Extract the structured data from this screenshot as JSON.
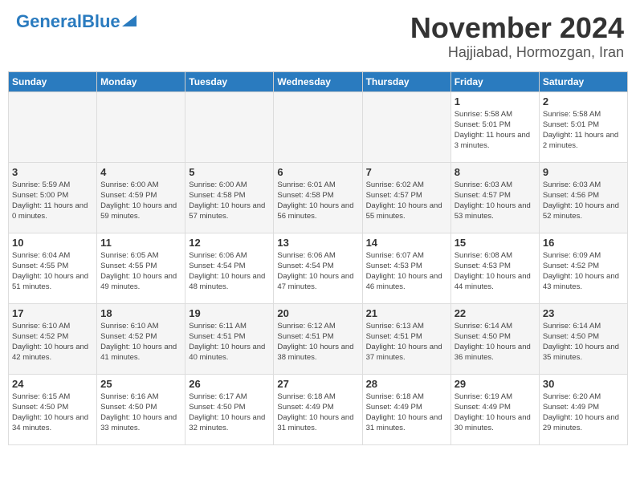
{
  "header": {
    "logo_general": "General",
    "logo_blue": "Blue",
    "month": "November 2024",
    "location": "Hajjiabad, Hormozgan, Iran"
  },
  "days_of_week": [
    "Sunday",
    "Monday",
    "Tuesday",
    "Wednesday",
    "Thursday",
    "Friday",
    "Saturday"
  ],
  "weeks": [
    [
      {
        "day": "",
        "empty": true
      },
      {
        "day": "",
        "empty": true
      },
      {
        "day": "",
        "empty": true
      },
      {
        "day": "",
        "empty": true
      },
      {
        "day": "",
        "empty": true
      },
      {
        "day": "1",
        "sunrise": "5:58 AM",
        "sunset": "5:01 PM",
        "daylight": "11 hours and 3 minutes."
      },
      {
        "day": "2",
        "sunrise": "5:58 AM",
        "sunset": "5:01 PM",
        "daylight": "11 hours and 2 minutes."
      }
    ],
    [
      {
        "day": "3",
        "sunrise": "5:59 AM",
        "sunset": "5:00 PM",
        "daylight": "11 hours and 0 minutes."
      },
      {
        "day": "4",
        "sunrise": "6:00 AM",
        "sunset": "4:59 PM",
        "daylight": "10 hours and 59 minutes."
      },
      {
        "day": "5",
        "sunrise": "6:00 AM",
        "sunset": "4:58 PM",
        "daylight": "10 hours and 57 minutes."
      },
      {
        "day": "6",
        "sunrise": "6:01 AM",
        "sunset": "4:58 PM",
        "daylight": "10 hours and 56 minutes."
      },
      {
        "day": "7",
        "sunrise": "6:02 AM",
        "sunset": "4:57 PM",
        "daylight": "10 hours and 55 minutes."
      },
      {
        "day": "8",
        "sunrise": "6:03 AM",
        "sunset": "4:57 PM",
        "daylight": "10 hours and 53 minutes."
      },
      {
        "day": "9",
        "sunrise": "6:03 AM",
        "sunset": "4:56 PM",
        "daylight": "10 hours and 52 minutes."
      }
    ],
    [
      {
        "day": "10",
        "sunrise": "6:04 AM",
        "sunset": "4:55 PM",
        "daylight": "10 hours and 51 minutes."
      },
      {
        "day": "11",
        "sunrise": "6:05 AM",
        "sunset": "4:55 PM",
        "daylight": "10 hours and 49 minutes."
      },
      {
        "day": "12",
        "sunrise": "6:06 AM",
        "sunset": "4:54 PM",
        "daylight": "10 hours and 48 minutes."
      },
      {
        "day": "13",
        "sunrise": "6:06 AM",
        "sunset": "4:54 PM",
        "daylight": "10 hours and 47 minutes."
      },
      {
        "day": "14",
        "sunrise": "6:07 AM",
        "sunset": "4:53 PM",
        "daylight": "10 hours and 46 minutes."
      },
      {
        "day": "15",
        "sunrise": "6:08 AM",
        "sunset": "4:53 PM",
        "daylight": "10 hours and 44 minutes."
      },
      {
        "day": "16",
        "sunrise": "6:09 AM",
        "sunset": "4:52 PM",
        "daylight": "10 hours and 43 minutes."
      }
    ],
    [
      {
        "day": "17",
        "sunrise": "6:10 AM",
        "sunset": "4:52 PM",
        "daylight": "10 hours and 42 minutes."
      },
      {
        "day": "18",
        "sunrise": "6:10 AM",
        "sunset": "4:52 PM",
        "daylight": "10 hours and 41 minutes."
      },
      {
        "day": "19",
        "sunrise": "6:11 AM",
        "sunset": "4:51 PM",
        "daylight": "10 hours and 40 minutes."
      },
      {
        "day": "20",
        "sunrise": "6:12 AM",
        "sunset": "4:51 PM",
        "daylight": "10 hours and 38 minutes."
      },
      {
        "day": "21",
        "sunrise": "6:13 AM",
        "sunset": "4:51 PM",
        "daylight": "10 hours and 37 minutes."
      },
      {
        "day": "22",
        "sunrise": "6:14 AM",
        "sunset": "4:50 PM",
        "daylight": "10 hours and 36 minutes."
      },
      {
        "day": "23",
        "sunrise": "6:14 AM",
        "sunset": "4:50 PM",
        "daylight": "10 hours and 35 minutes."
      }
    ],
    [
      {
        "day": "24",
        "sunrise": "6:15 AM",
        "sunset": "4:50 PM",
        "daylight": "10 hours and 34 minutes."
      },
      {
        "day": "25",
        "sunrise": "6:16 AM",
        "sunset": "4:50 PM",
        "daylight": "10 hours and 33 minutes."
      },
      {
        "day": "26",
        "sunrise": "6:17 AM",
        "sunset": "4:50 PM",
        "daylight": "10 hours and 32 minutes."
      },
      {
        "day": "27",
        "sunrise": "6:18 AM",
        "sunset": "4:49 PM",
        "daylight": "10 hours and 31 minutes."
      },
      {
        "day": "28",
        "sunrise": "6:18 AM",
        "sunset": "4:49 PM",
        "daylight": "10 hours and 31 minutes."
      },
      {
        "day": "29",
        "sunrise": "6:19 AM",
        "sunset": "4:49 PM",
        "daylight": "10 hours and 30 minutes."
      },
      {
        "day": "30",
        "sunrise": "6:20 AM",
        "sunset": "4:49 PM",
        "daylight": "10 hours and 29 minutes."
      }
    ]
  ]
}
